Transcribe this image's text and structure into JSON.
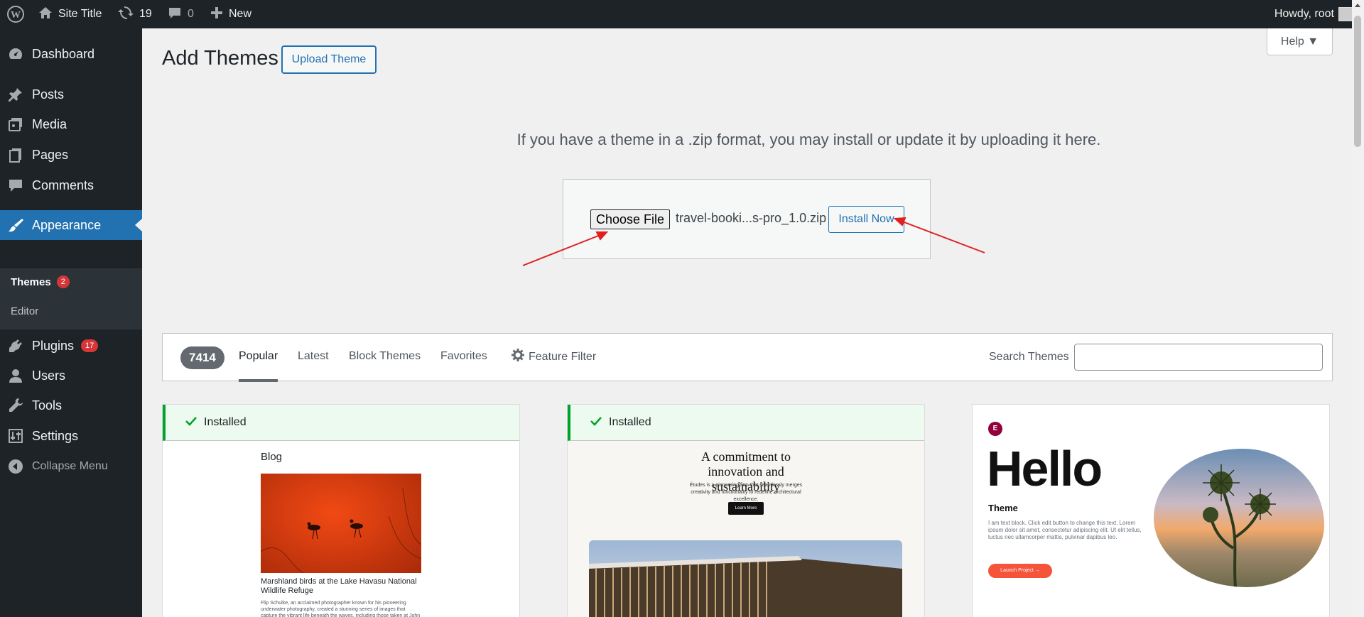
{
  "admin_bar": {
    "site_title": "Site Title",
    "updates_count": "19",
    "comments_count": "0",
    "new_label": "New",
    "howdy": "Howdy, root"
  },
  "sidebar": {
    "dashboard": "Dashboard",
    "posts": "Posts",
    "media": "Media",
    "pages": "Pages",
    "comments": "Comments",
    "appearance": "Appearance",
    "themes": "Themes",
    "themes_badge": "2",
    "editor": "Editor",
    "plugins": "Plugins",
    "plugins_badge": "17",
    "users": "Users",
    "tools": "Tools",
    "settings": "Settings",
    "collapse": "Collapse Menu"
  },
  "header": {
    "title": "Add Themes",
    "upload_button": "Upload Theme",
    "help_button": "Help ▼"
  },
  "upload": {
    "description": "If you have a theme in a .zip format, you may install or update it by uploading it here.",
    "choose_file": "Choose File",
    "file_name": "travel-booki...s-pro_1.0.zip",
    "install_now": "Install Now"
  },
  "filter": {
    "count": "7414",
    "tabs": [
      "Popular",
      "Latest",
      "Block Themes",
      "Favorites"
    ],
    "feature_filter": "Feature Filter",
    "search_label": "Search Themes",
    "search_value": ""
  },
  "themes": [
    {
      "installed_label": "Installed",
      "preview_title": "Blog",
      "preview_caption": "Marshland birds at the Lake Havasu National Wildlife Refuge",
      "preview_text": "Flip Schulke, an acclaimed photographer known for his pioneering underwater photography, created a stunning series of images that capture the vibrant life beneath the waves, including those taken at John Pennekamp Coral Reef State Park, located a few miles off Key Largo. Both dock and pier"
    },
    {
      "installed_label": "Installed",
      "preview_heading": "A commitment to innovation and sustainability",
      "preview_text": "Études is a pioneering firm that seamlessly merges creativity and functionality to redefine architectural excellence.",
      "preview_button": "Learn More"
    },
    {
      "logo": "E",
      "preview_heading": "Hello",
      "preview_sub": "Theme",
      "preview_text": "I am text block. Click edit button to change this text. Lorem ipsum dolor sit amet, consectetur adipiscing elit. Ut elit tellus, luctus nec ullamcorper mattis, pulvinar dapibus leo.",
      "preview_button": "Launch Project →"
    }
  ],
  "colors": {
    "admin_dark": "#1d2327",
    "accent": "#2271b1",
    "badge": "#d63638",
    "installed_green": "#00a32a",
    "annotation_arrow": "#e02020"
  }
}
